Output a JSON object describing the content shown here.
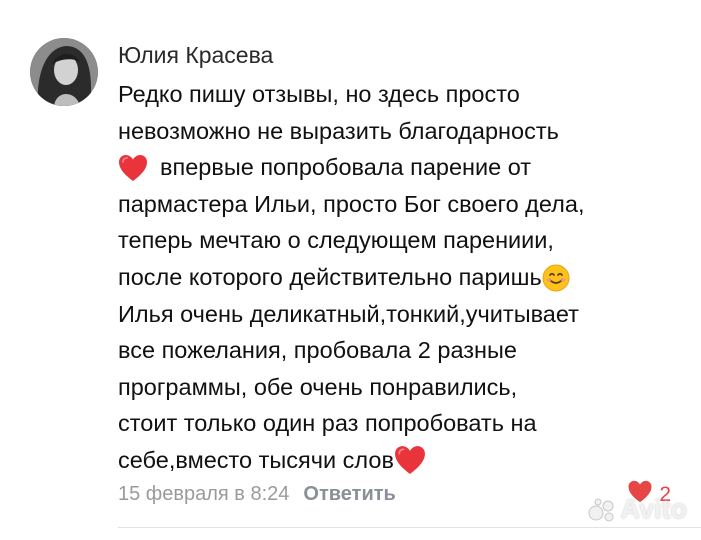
{
  "author": {
    "name": "Юлия Красева"
  },
  "comment": {
    "lines": [
      "Редко пишу отзывы, но здесь просто",
      "невозможно не выразить благодарность",
      "впервые попробовала парение от",
      "пармастера Ильи, просто Бог своего дела,",
      "теперь мечтаю о следующем парениии,",
      "после которого действительно паришь",
      "Илья очень деликатный,тонкий,учитывает",
      "все пожелания, пробовала 2 разные",
      "программы, обе очень понравились,",
      "стоит только один раз попробовать на",
      "себе,вместо тысячи слов"
    ]
  },
  "meta": {
    "date": "15 февраля в 8:24",
    "reply_label": "Ответить"
  },
  "likes": {
    "count": "2",
    "color": "#e64646"
  },
  "icons": {
    "heart": "heart-emoji",
    "smile": "smiling-face-emoji",
    "like": "heart-icon"
  },
  "watermark": {
    "text": "Avito"
  }
}
